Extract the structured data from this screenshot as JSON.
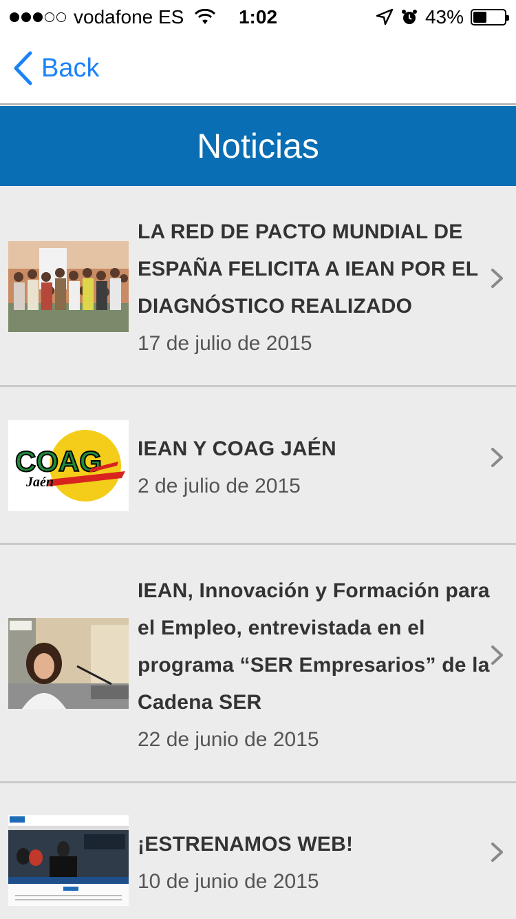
{
  "status_bar": {
    "carrier": "vodafone ES",
    "signal_bars": 3,
    "signal_total": 5,
    "time": "1:02",
    "battery": "43%",
    "battery_fraction": 0.43
  },
  "nav": {
    "back_label": "Back"
  },
  "header": {
    "title": "Noticias"
  },
  "news": [
    {
      "title": "LA RED DE PACTO MUNDIAL DE ESPAÑA FELICITA A IEAN POR EL DIAGNÓSTICO REALIZADO",
      "date": "17 de julio de 2015",
      "thumb": "group-photo"
    },
    {
      "title": "IEAN Y COAG JAÉN",
      "date": "2 de julio de 2015",
      "thumb": "coag-logo",
      "logo_text": "COAG",
      "logo_sub": "Jaén"
    },
    {
      "title": "IEAN, Innovación y Formación para el Empleo, entrevistada en el programa “SER Empresarios” de la Cadena SER",
      "date": "22 de junio de 2015",
      "thumb": "radio-photo"
    },
    {
      "title": "¡ESTRENAMOS WEB!",
      "date": "10 de junio de 2015",
      "thumb": "website-screenshot"
    }
  ],
  "colors": {
    "header_bg": "#0a6eb4",
    "back_blue": "#1a82f7",
    "list_bg": "#ececec"
  }
}
